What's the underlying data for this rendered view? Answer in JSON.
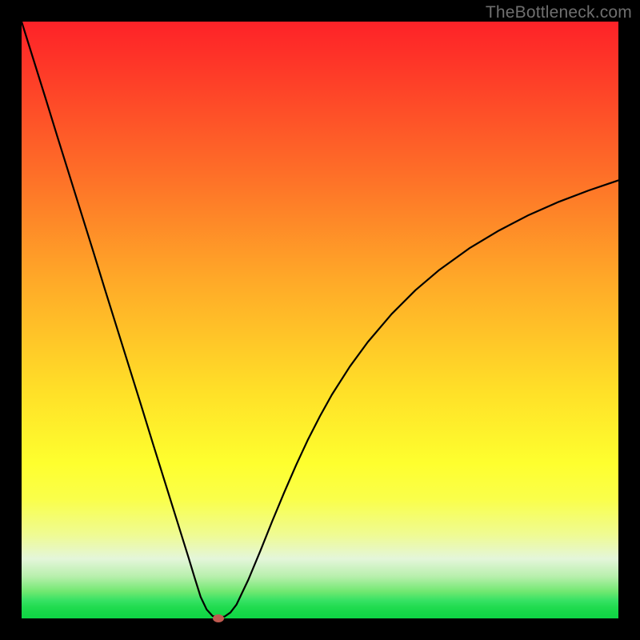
{
  "watermark": "TheBottleneck.com",
  "chart_data": {
    "type": "line",
    "title": "",
    "xlabel": "",
    "ylabel": "",
    "xlim": [
      0,
      100
    ],
    "ylim": [
      0,
      100
    ],
    "grid": false,
    "legend": false,
    "series": [
      {
        "name": "bottleneck-curve",
        "x": [
          0,
          2,
          4,
          6,
          8,
          10,
          12,
          14,
          16,
          18,
          20,
          22,
          24,
          26,
          28,
          29,
          30,
          31,
          32,
          33,
          34,
          35,
          36,
          38,
          40,
          42,
          44,
          46,
          48,
          50,
          52,
          55,
          58,
          62,
          66,
          70,
          75,
          80,
          85,
          90,
          95,
          100
        ],
        "y": [
          100,
          93.6,
          87.2,
          80.7,
          74.3,
          67.9,
          61.5,
          55.0,
          48.6,
          42.2,
          35.8,
          29.3,
          22.9,
          16.5,
          10.1,
          6.8,
          3.6,
          1.5,
          0.4,
          0.2,
          0.3,
          1.0,
          2.3,
          6.5,
          11.3,
          16.3,
          21.1,
          25.7,
          30.0,
          33.9,
          37.5,
          42.2,
          46.3,
          51.0,
          55.0,
          58.4,
          62.0,
          65.0,
          67.6,
          69.8,
          71.7,
          73.4
        ]
      }
    ],
    "optimum_marker": {
      "x": 33,
      "y": 0
    },
    "background_gradient": {
      "type": "vertical",
      "stops": [
        {
          "pos": 0.0,
          "color": "#fe2228"
        },
        {
          "pos": 0.25,
          "color": "#fe6d28"
        },
        {
          "pos": 0.5,
          "color": "#ffc628"
        },
        {
          "pos": 0.75,
          "color": "#feff2e"
        },
        {
          "pos": 0.92,
          "color": "#b7efac"
        },
        {
          "pos": 1.0,
          "color": "#0fd545"
        }
      ]
    }
  }
}
